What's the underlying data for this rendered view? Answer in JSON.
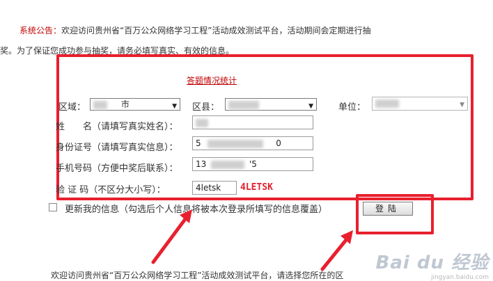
{
  "notice": {
    "label": "系统公告：",
    "line1": "欢迎访问贵州省“百万公众网络学习工程”活动成效测试平台，活动期间会定期进行抽",
    "line2": "奖。为了保证您成功参与抽奖，请务必填写真实、有效的信息。"
  },
  "form": {
    "title": "答题情况统计",
    "region_label": "区域：",
    "region_value": "市",
    "district_label": "区县：",
    "unit_label": "单位：",
    "name_label": "姓　　名（请填写真实姓名）：",
    "id_label": "身份证号（请填写真实信息）：",
    "id_value_start": "5",
    "id_value_end": "0",
    "phone_label": "手机号码（方便中奖后联系）：",
    "phone_value_start": "13",
    "phone_value_end": "'5",
    "captcha_label": "验 证 码（不区分大小写）：",
    "captcha_input": "4letsk",
    "captcha_image_text": "4LETSK",
    "update_label": "更新我的信息（勾选后个人信息将被本次登录所填写的信息覆盖）",
    "login_button": "登陆"
  },
  "footer": {
    "text": "欢迎访问贵州省“百万公众网络学习工程”活动成效测试平台，请选择您所在的区"
  },
  "watermark": {
    "brand": "Bai du 经验",
    "url": "jingyan.baidu.com"
  },
  "colors": {
    "annotation_red": "#e8202e",
    "label_red": "#c00000"
  },
  "icons": [
    "dropdown-arrow-icon",
    "checkbox-icon",
    "annotation-arrow-icon"
  ]
}
